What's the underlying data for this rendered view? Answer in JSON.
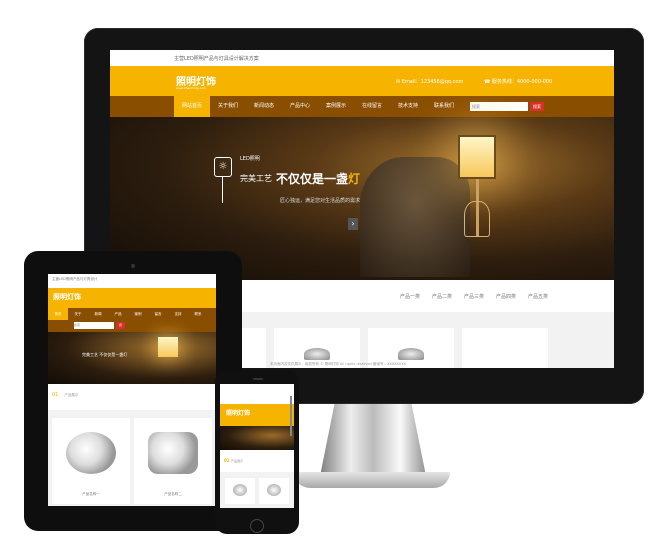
{
  "desktop": {
    "topbar_text": "主营LED照明产品与灯具设计解决方案",
    "logo": "照明灯饰",
    "logo_sub": "www.zhaoming.com",
    "contact_email": "Email：123456@qq.com",
    "contact_phone": "服务热线：4000-000-000",
    "nav": [
      "网站首页",
      "关于我们",
      "新闻动态",
      "产品中心",
      "案例展示",
      "在线留言",
      "技术支持",
      "联系我们"
    ],
    "search_placeholder": "搜索",
    "search_button": "搜索",
    "hero": {
      "tag": "LED照明",
      "line1": "完美工艺",
      "line2_main": "不仅仅是一盏",
      "line2_accent": "灯",
      "subtitle": "匠心独运，满足您对生活品质的需求"
    },
    "categories": [
      "产品一类",
      "产品二类",
      "产品三类",
      "产品四类",
      "产品五类"
    ],
    "footer_text": "本页面内容仅供展示，版权所有 © 照明灯饰 All rights reserved 备案号：XXXXXXXX"
  },
  "tablet": {
    "top_text": "主营LED照明产品与灯具设计",
    "logo": "照明灯饰",
    "nav": [
      "首页",
      "关于",
      "新闻",
      "产品",
      "案例",
      "留言",
      "支持",
      "联系"
    ],
    "search_placeholder": "搜索",
    "search_button": "搜",
    "hero_text": "完美工艺 不仅仅是一盏灯",
    "section_num": "01",
    "section_title": "产品展示",
    "card_labels": [
      "产品名称一",
      "产品名称二"
    ]
  },
  "phone": {
    "logo": "照明灯饰",
    "section_num": "01",
    "section_title": "产品展示"
  },
  "colors": {
    "accent": "#f6b400",
    "nav": "#8a4e00",
    "button": "#d9302a"
  }
}
